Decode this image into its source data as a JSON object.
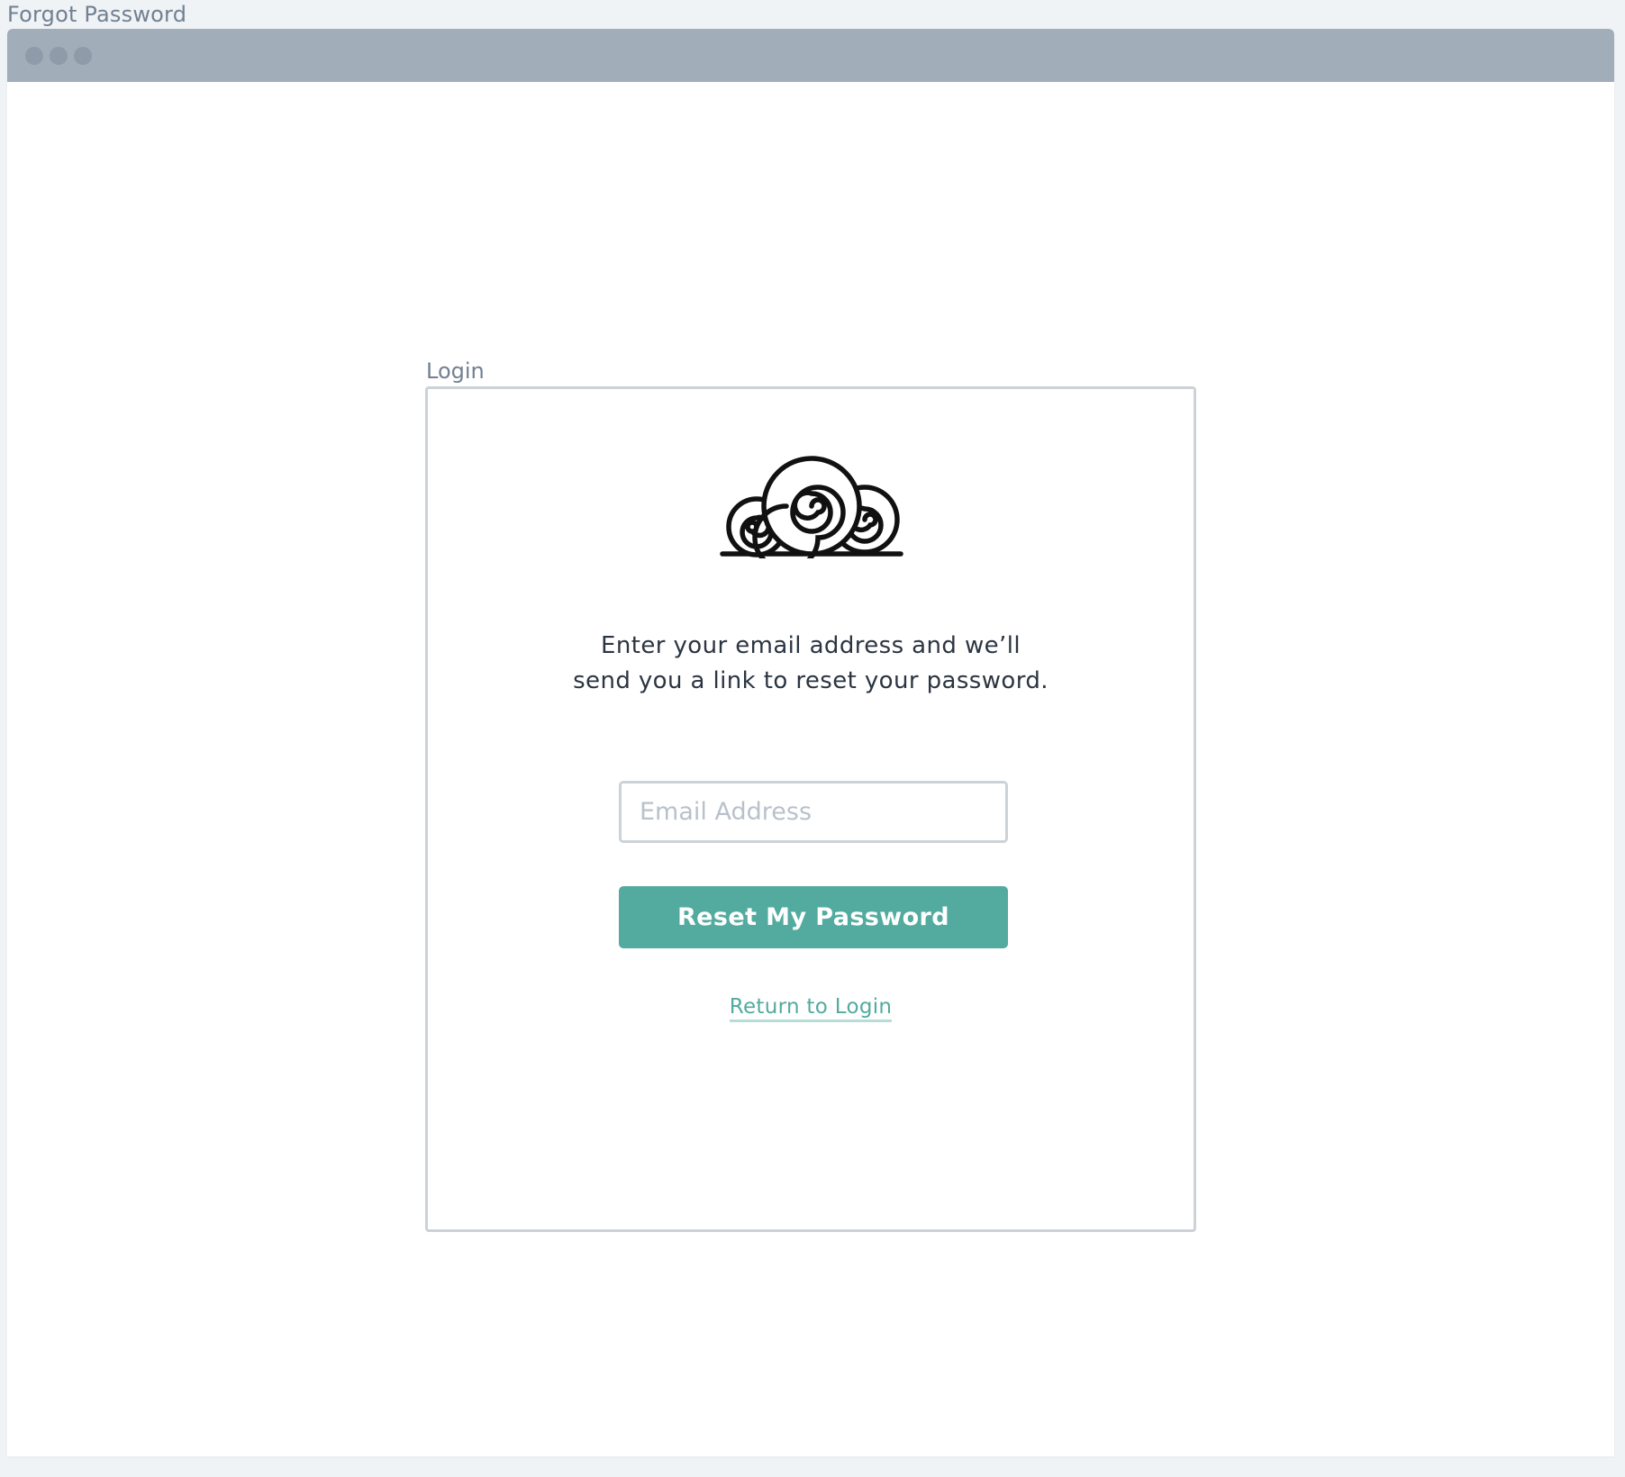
{
  "frame": {
    "title": "Forgot Password"
  },
  "browser": {
    "controls": [
      "window-dot",
      "window-dot",
      "window-dot"
    ]
  },
  "card": {
    "label": "Login",
    "logo_icon": "spiral-hay-bales-logo-icon",
    "instructions_line1": "Enter your email address and we’ll",
    "instructions_line2": "send you a link to reset your password.",
    "email": {
      "value": "",
      "placeholder": "Email Address"
    },
    "reset_button_label": "Reset My Password",
    "return_link_label": "Return to Login"
  },
  "colors": {
    "accent": "#52ab9e",
    "chrome": "#a1adb9",
    "border": "#cdd2d9",
    "text": "#2b3542",
    "muted": "#728091"
  }
}
